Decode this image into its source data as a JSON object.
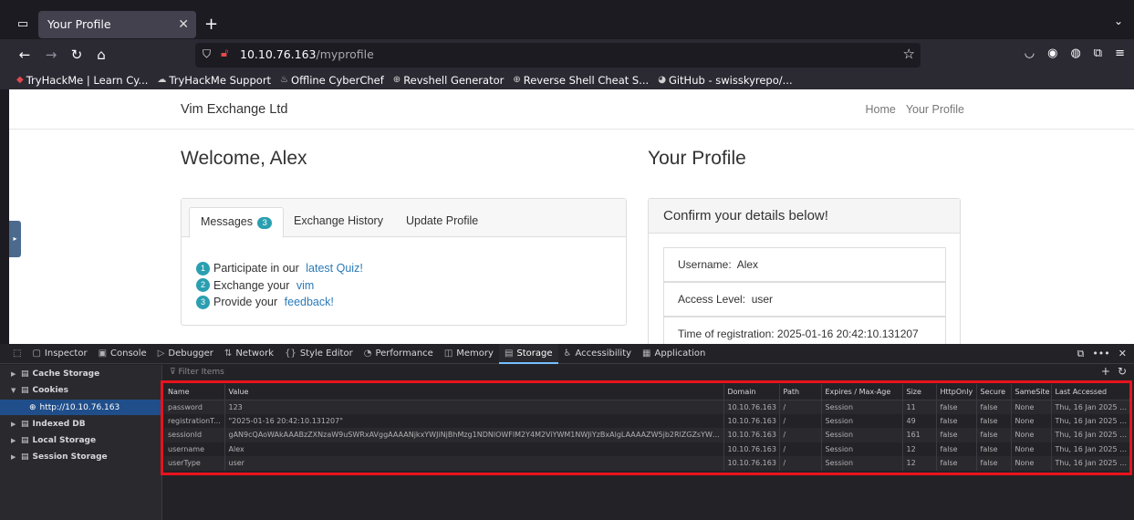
{
  "browser": {
    "tab_title": "Your Profile",
    "close_glyph": "✕",
    "new_tab_glyph": "+",
    "url_host": "10.10.76.163",
    "url_path": "/myprofile",
    "bookmarks": [
      {
        "label": "TryHackMe | Learn Cy...",
        "icon": "thm-icon"
      },
      {
        "label": "TryHackMe Support",
        "icon": "support-icon"
      },
      {
        "label": "Offline CyberChef",
        "icon": "chef-icon"
      },
      {
        "label": "Revshell Generator",
        "icon": "globe-icon"
      },
      {
        "label": "Reverse Shell Cheat S...",
        "icon": "globe-icon"
      },
      {
        "label": "GitHub - swisskyrepo/...",
        "icon": "github-icon"
      }
    ]
  },
  "site": {
    "brand": "Vim Exchange Ltd",
    "nav": [
      "Home",
      "Your Profile"
    ],
    "welcome": "Welcome, Alex",
    "profile_title": "Your Profile",
    "tabs": {
      "messages": "Messages",
      "messages_count": "3",
      "history": "Exchange History",
      "update": "Update Profile"
    },
    "messages": [
      {
        "num": "1",
        "prefix": "Participate in our ",
        "link": "latest Quiz!"
      },
      {
        "num": "2",
        "prefix": "Exchange your ",
        "link": "vim"
      },
      {
        "num": "3",
        "prefix": "Provide your ",
        "link": "feedback!"
      }
    ],
    "confirm_heading": "Confirm your details below!",
    "details": [
      "Username:  Alex",
      "Access Level:  user",
      "Time of registration: 2025-01-16 20:42:10.131207"
    ]
  },
  "devtools": {
    "tabs": [
      "Inspector",
      "Console",
      "Debugger",
      "Network",
      "Style Editor",
      "Performance",
      "Memory",
      "Storage",
      "Accessibility",
      "Application"
    ],
    "active_tab": "Storage",
    "tree": {
      "cache": "Cache Storage",
      "cookies": "Cookies",
      "cookie_host": "http://10.10.76.163",
      "indexed": "Indexed DB",
      "local": "Local Storage",
      "session": "Session Storage"
    },
    "filter_placeholder": "Filter Items",
    "columns": [
      "Name",
      "Value",
      "Domain",
      "Path",
      "Expires / Max-Age",
      "Size",
      "HttpOnly",
      "Secure",
      "SameSite",
      "Last Accessed"
    ],
    "rows": [
      [
        "password",
        "123",
        "10.10.76.163",
        "/",
        "Session",
        "11",
        "false",
        "false",
        "None",
        "Thu, 16 Jan 2025 2..."
      ],
      [
        "registrationT...",
        "\"2025-01-16 20:42:10.131207\"",
        "10.10.76.163",
        "/",
        "Session",
        "49",
        "false",
        "false",
        "None",
        "Thu, 16 Jan 2025 2..."
      ],
      [
        "sessionId",
        "gAN9cQAoWAkAAABzZXNzaW9uSWRxAVggAAAANjkxYWJiNjBhMzg1NDNlOWFlM2Y4M2ViYWM1NWJiYzBxAlgLAAAAZW5jb2RlZGZsYWd...",
        "10.10.76.163",
        "/",
        "Session",
        "161",
        "false",
        "false",
        "None",
        "Thu, 16 Jan 2025 2..."
      ],
      [
        "username",
        "Alex",
        "10.10.76.163",
        "/",
        "Session",
        "12",
        "false",
        "false",
        "None",
        "Thu, 16 Jan 2025 2..."
      ],
      [
        "userType",
        "user",
        "10.10.76.163",
        "/",
        "Session",
        "12",
        "false",
        "false",
        "None",
        "Thu, 16 Jan 2025 2..."
      ]
    ]
  },
  "colors": {
    "highlight": "#e8131d",
    "accent": "#2a9fb0",
    "link": "#2a7ab8"
  }
}
